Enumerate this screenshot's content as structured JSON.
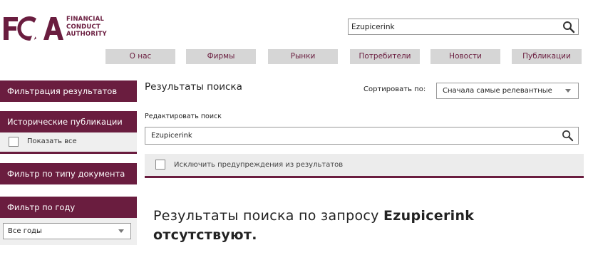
{
  "header": {
    "logo_letters": "FCA",
    "logo_lines": [
      "FINANCIAL",
      "CONDUCT",
      "AUTHORITY"
    ],
    "search_value": "Ezupicerink"
  },
  "nav": [
    {
      "label": "О нас"
    },
    {
      "label": "Фирмы"
    },
    {
      "label": "Рынки"
    },
    {
      "label": "Потребители"
    },
    {
      "label": "Новости"
    },
    {
      "label": "Публикации"
    }
  ],
  "sidebar": {
    "filter_results": "Фильтрация результатов",
    "historic_pubs": "Исторические публикации",
    "show_all": "Показать все",
    "doc_type_filter": "Фильтр по типу документа",
    "year_filter": "Фильтр по году",
    "year_selected": "Все годы"
  },
  "main": {
    "title": "Результаты поиска",
    "sort_label": "Сортировать по:",
    "sort_selected": "Сначала самые релевантные",
    "edit_search_label": "Редактировать поиск",
    "search_value": "Ezupicerink",
    "exclude_warnings_label": "Исключить предупреждения из результатов",
    "no_results_prefix": "Результаты поиска по запросу",
    "no_results_query": "Ezupicerink",
    "no_results_suffix": "отсутствуют."
  },
  "colors": {
    "brand": "#6a1d3f",
    "nav_bg": "#d6d6d6",
    "panel_bg": "#efefef"
  }
}
